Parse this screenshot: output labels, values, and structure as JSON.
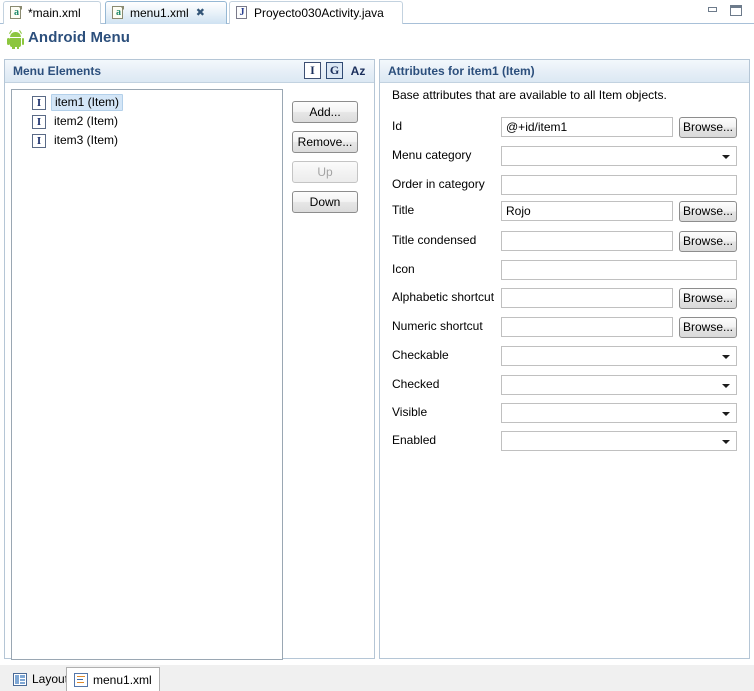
{
  "window": {
    "minimize_icon": "minimize-icon",
    "maximize_icon": "maximize-icon"
  },
  "editor_tabs": [
    {
      "label": "*main.xml",
      "icon": "xml-file-icon",
      "active": false,
      "closable": false
    },
    {
      "label": "menu1.xml",
      "icon": "xml-file-icon",
      "active": true,
      "closable": true,
      "close_glyph": "✖"
    },
    {
      "label": "Proyecto030Activity.java",
      "icon": "java-file-icon",
      "active": false,
      "closable": false
    }
  ],
  "page": {
    "title": "Android Menu",
    "icon": "android-robot-icon"
  },
  "menu_elements": {
    "section_title": "Menu Elements",
    "toolbar": [
      {
        "label": "I",
        "name": "filter-item-button",
        "pressed": false
      },
      {
        "label": "G",
        "name": "filter-group-button",
        "pressed": true
      },
      {
        "label": "Az",
        "name": "sort-alphabetically-button",
        "pressed": false
      }
    ],
    "tree_items": [
      {
        "icon_glyph": "I",
        "label": "item1 (Item)",
        "selected": true
      },
      {
        "icon_glyph": "I",
        "label": "item2 (Item)",
        "selected": false
      },
      {
        "icon_glyph": "I",
        "label": "item3 (Item)",
        "selected": false
      }
    ],
    "buttons": [
      {
        "label": "Add...",
        "name": "add-button",
        "disabled": false
      },
      {
        "label": "Remove...",
        "name": "remove-button",
        "disabled": false
      },
      {
        "label": "Up",
        "name": "move-up-button",
        "disabled": true
      },
      {
        "label": "Down",
        "name": "move-down-button",
        "disabled": false
      }
    ]
  },
  "attributes": {
    "section_title": "Attributes for item1 (Item)",
    "description": "Base attributes that are available to all Item objects.",
    "browse_label": "Browse...",
    "fields": [
      {
        "label": "Id",
        "type": "text",
        "value": "@+id/item1",
        "browse": true
      },
      {
        "label": "Menu category",
        "type": "combo",
        "value": "",
        "browse": false
      },
      {
        "label": "Order in category",
        "type": "text",
        "value": "",
        "browse": false
      },
      {
        "label": "Title",
        "type": "text",
        "value": "Rojo",
        "browse": true
      },
      {
        "label": "Title condensed",
        "type": "text",
        "value": "",
        "browse": true
      },
      {
        "label": "Icon",
        "type": "text",
        "value": "",
        "browse": false
      },
      {
        "label": "Alphabetic shortcut",
        "type": "text",
        "value": "",
        "browse": true
      },
      {
        "label": "Numeric shortcut",
        "type": "text",
        "value": "",
        "browse": true
      },
      {
        "label": "Checkable",
        "type": "combo",
        "value": "",
        "browse": false
      },
      {
        "label": "Checked",
        "type": "combo",
        "value": "",
        "browse": false
      },
      {
        "label": "Visible",
        "type": "combo",
        "value": "",
        "browse": false
      },
      {
        "label": "Enabled",
        "type": "combo",
        "value": "",
        "browse": false
      }
    ]
  },
  "bottom_tabs": [
    {
      "label": "Layout",
      "icon": "layout-view-icon",
      "active": false
    },
    {
      "label": "menu1.xml",
      "icon": "xml-source-icon",
      "active": true
    }
  ],
  "colors": {
    "title_blue": "#2c4f7c",
    "android_green": "#8cc63e",
    "selection_blue": "#d4e6f7",
    "section_border": "#b5c6d6"
  }
}
